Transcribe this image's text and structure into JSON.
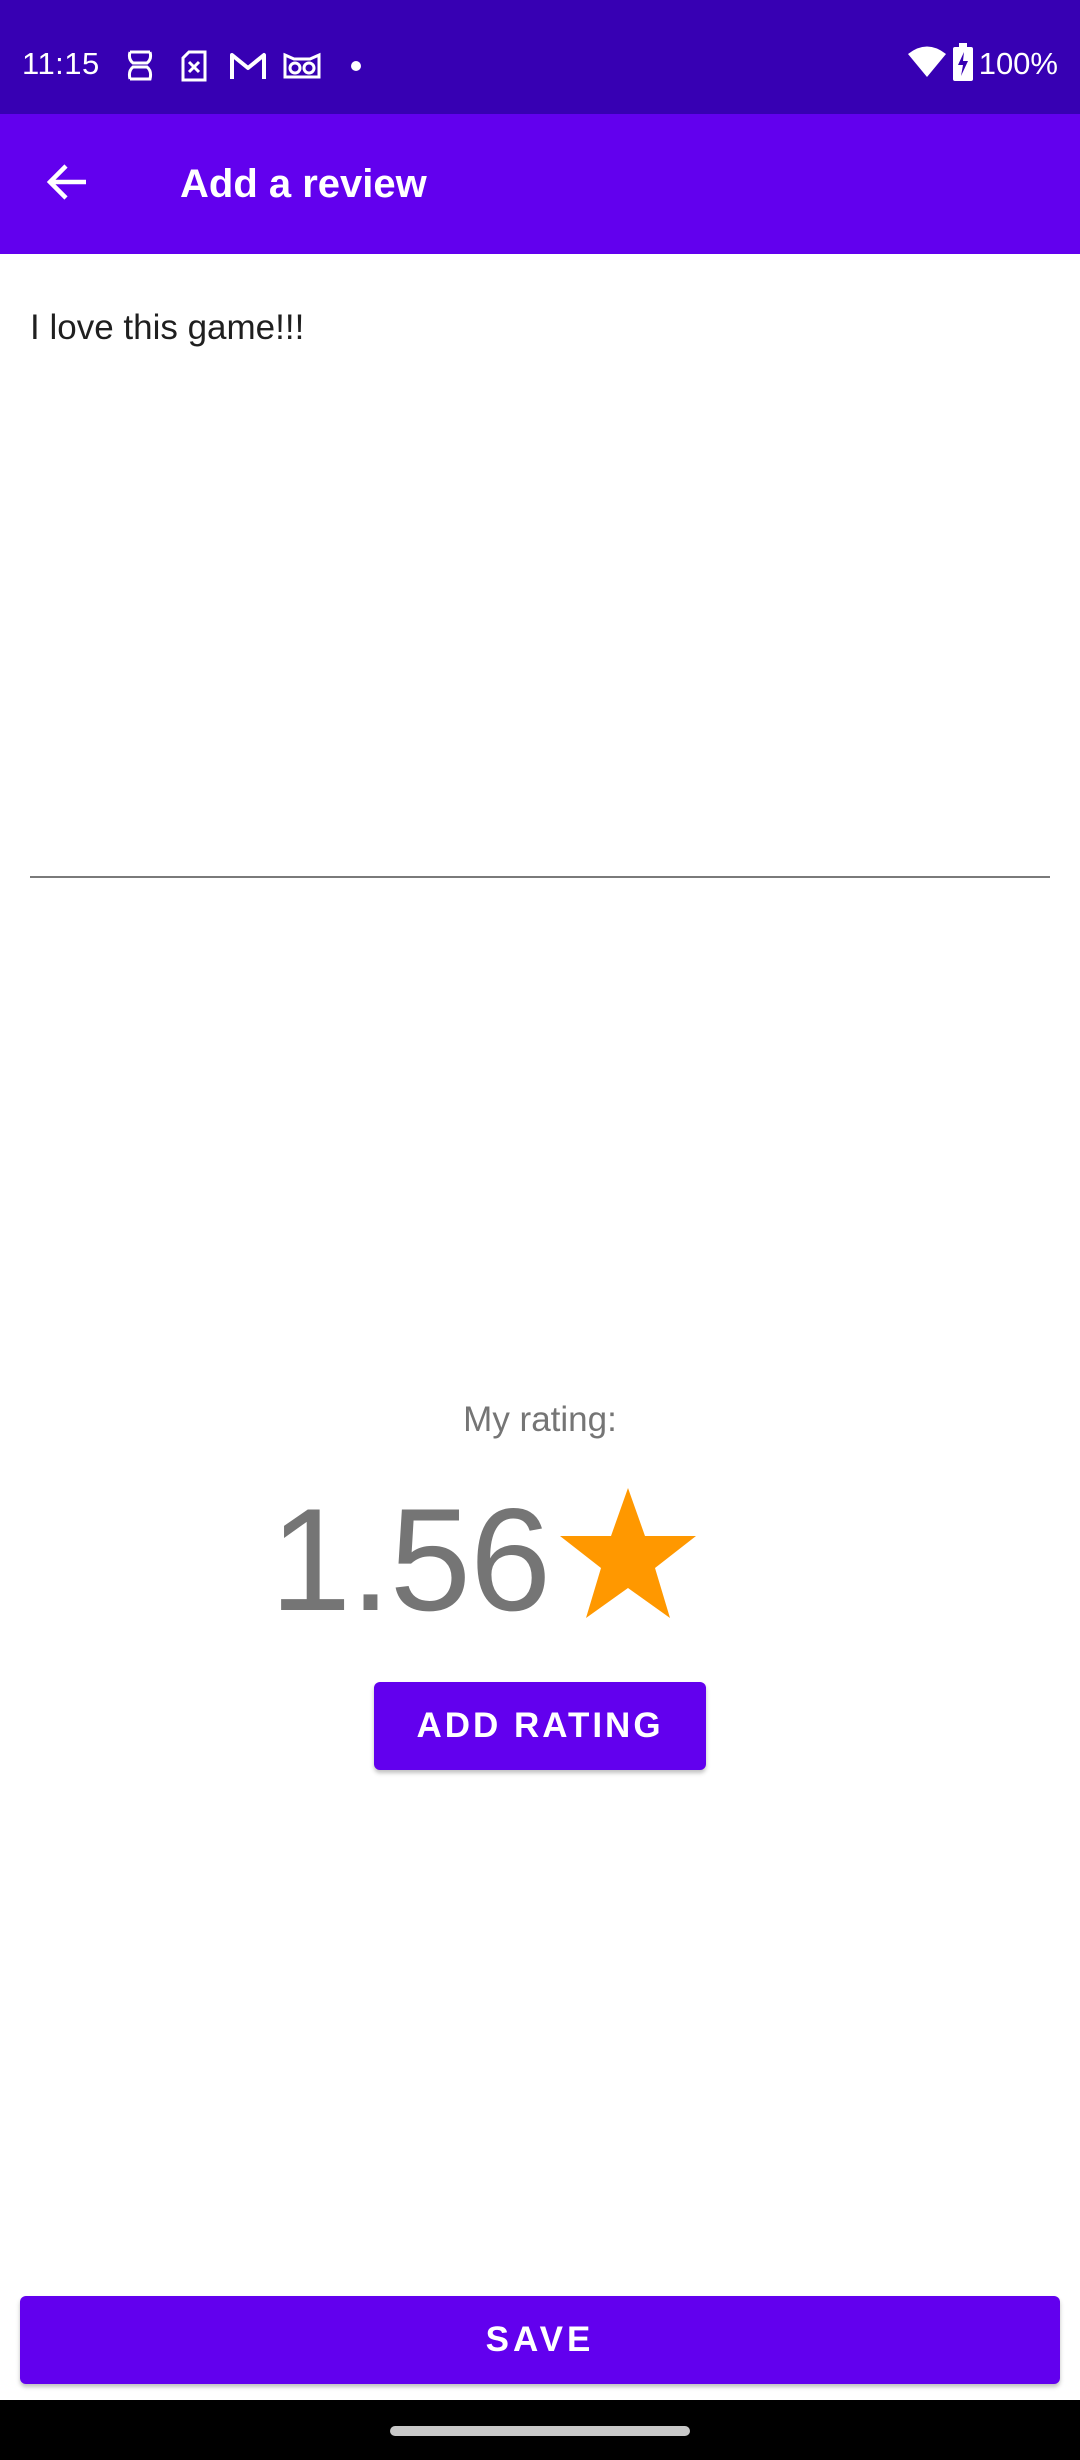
{
  "status_bar": {
    "time": "11:15",
    "notification_icons": [
      "sim-alert-icon",
      "sd-card-x-icon",
      "gmail-icon",
      "owl-app-icon",
      "more-dot-icon"
    ],
    "system_icons": [
      "wifi-icon",
      "battery-charging-icon"
    ],
    "battery_percent": "100%"
  },
  "app_bar": {
    "title": "Add a review",
    "back_icon": "arrow-back-icon"
  },
  "review": {
    "text": "I love this game!!!"
  },
  "rating": {
    "label": "My rating:",
    "value": "1.56",
    "icon": "star-icon",
    "star_color": "#ff9800",
    "add_button_label": "ADD RATING"
  },
  "actions": {
    "save_label": "SAVE"
  },
  "colors": {
    "status_bar": "#3700b3",
    "primary": "#6200ee",
    "secondary_text": "#757575"
  }
}
